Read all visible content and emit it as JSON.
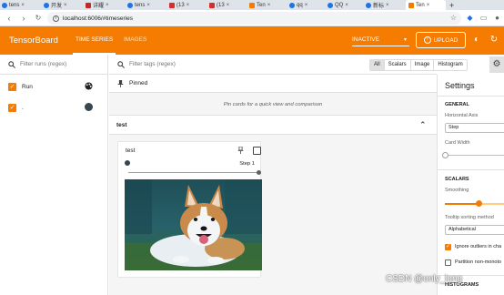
{
  "browser": {
    "tabs": [
      {
        "label": "tens",
        "color": "#1a73e8"
      },
      {
        "label": "开发",
        "color": "#1a73e8"
      },
      {
        "label": "详耀",
        "color": "#c62828"
      },
      {
        "label": "tens",
        "color": "#1a73e8"
      },
      {
        "label": "(13",
        "color": "#d32f2f"
      },
      {
        "label": "(13",
        "color": "#d32f2f"
      },
      {
        "label": "Ten",
        "color": "#f57c00"
      },
      {
        "label": "qq",
        "color": "#1a73e8"
      },
      {
        "label": "QQ",
        "color": "#1a73e8"
      },
      {
        "label": "新标",
        "color": "#1a73e8"
      },
      {
        "label": "Ten",
        "color": "#f57c00"
      }
    ],
    "url": "localhost:6006/#timeseries"
  },
  "header": {
    "brand": "TensorBoard",
    "tabs": [
      "TIME SERIES",
      "IMAGES"
    ],
    "status_select": "INACTIVE",
    "upload_label": "UPLOAD"
  },
  "sidebar": {
    "filter_placeholder": "Filter runs (regex)",
    "runs": [
      {
        "label": "Run",
        "checked": true
      },
      {
        "label": ".",
        "checked": true
      }
    ]
  },
  "main": {
    "tags_placeholder": "Filter tags (regex)",
    "type_buttons": [
      "All",
      "Scalars",
      "Image",
      "Histogram"
    ],
    "pinned_label": "Pinned",
    "pin_hint": "Pin cards for a quick view and comparison",
    "group_name": "test",
    "card": {
      "title": "test",
      "step_label": "Step 1"
    }
  },
  "settings": {
    "title": "Settings",
    "general_heading": "GENERAL",
    "horizontal_axis_label": "Horizontal Axis",
    "horizontal_axis_value": "Step",
    "card_width_label": "Card Width",
    "scalars_heading": "SCALARS",
    "smoothing_label": "Smoothing",
    "tooltip_sort_label": "Tooltip sorting method",
    "tooltip_sort_value": "Alphabetical",
    "ignore_outliers_label": "Ignore outliers in cha",
    "partition_label": "Partition non-monoto",
    "histograms_heading": "HISTOGRAMS"
  },
  "watermark": "CSDN @only_long",
  "colors": {
    "accent": "#f57c00",
    "header": "#f57c00"
  }
}
